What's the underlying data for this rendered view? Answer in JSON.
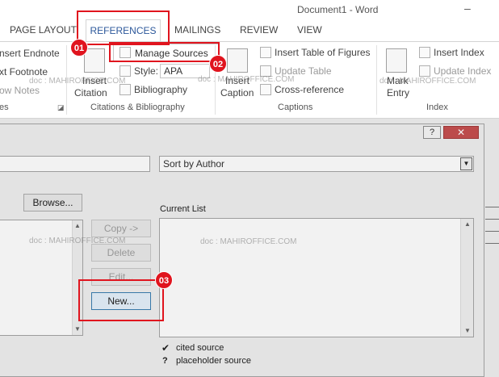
{
  "window": {
    "title": "Document1 - Word",
    "minimize_glyph": "–"
  },
  "ribbon": {
    "tabs": {
      "page_layout": "PAGE LAYOUT",
      "references": "REFERENCES",
      "mailings": "MAILINGS",
      "review": "REVIEW",
      "view": "VIEW"
    },
    "footnotes": {
      "insert_endnote": "nsert Endnote",
      "next_footnote": "xt Footnote",
      "show_notes": "ow Notes",
      "group_label": "es"
    },
    "citations": {
      "insert_citation_line1": "Insert",
      "insert_citation_line2": "Citation",
      "manage_sources": "Manage Sources",
      "style_label": "Style:",
      "style_value": "APA",
      "bibliography": "Bibliography",
      "group_label": "Citations & Bibliography"
    },
    "captions": {
      "insert_caption_line1": "Insert",
      "insert_caption_line2": "Caption",
      "insert_table_of_figures": "Insert Table of Figures",
      "update_table": "Update Table",
      "cross_reference": "Cross-reference",
      "group_label": "Captions"
    },
    "index": {
      "mark_entry_line1": "Mark",
      "mark_entry_line2": "Entry",
      "insert_index": "Insert Index",
      "update_index": "Update Index",
      "group_label": "Index"
    }
  },
  "dialog": {
    "help_glyph": "?",
    "close_glyph": "✕",
    "sort_value": "Sort by Author",
    "browse_button": "Browse...",
    "copy_button": "Copy ->",
    "delete_button": "Delete",
    "edit_button": "Edit...",
    "new_button": "New...",
    "current_list_label": "Current List",
    "legend": {
      "cited_icon": "✔",
      "cited_label": "cited source",
      "placeholder_icon": "?",
      "placeholder_label": "placeholder source"
    }
  },
  "annotations": {
    "step1": "01",
    "step2": "02",
    "step3": "03"
  },
  "watermark": "doc : MAHIROFFICE.COM",
  "colors": {
    "accent": "#2b579a",
    "callout": "#e0141e",
    "close_button": "#c75050"
  }
}
